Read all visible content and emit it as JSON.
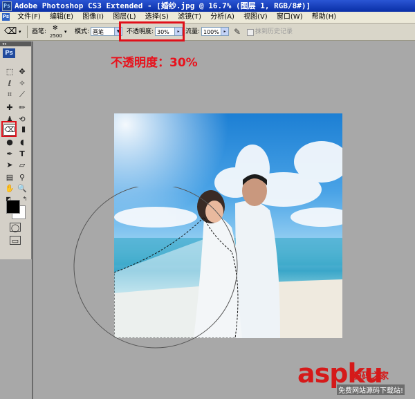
{
  "window": {
    "title": "Adobe Photoshop CS3 Extended - [婚纱.jpg @ 16.7% (图层 1, RGB/8#)]",
    "badge": "Ps"
  },
  "menu": {
    "app_icon": "Ps",
    "items": [
      "文件(F)",
      "编辑(E)",
      "图像(I)",
      "图层(L)",
      "选择(S)",
      "滤镜(T)",
      "分析(A)",
      "视图(V)",
      "窗口(W)",
      "帮助(H)"
    ]
  },
  "options": {
    "brush_label": "画笔:",
    "brush_size": "2500",
    "mode_label": "模式:",
    "mode_value": "画笔",
    "opacity_label": "不透明度:",
    "opacity_value": "30%",
    "flow_label": "流量:",
    "flow_value": "100%",
    "history_label": "抹到历史记录"
  },
  "annotation": {
    "text": "不透明度：30%"
  },
  "toolbox": {
    "logo": "Ps",
    "grip": "◂◂",
    "icons": [
      "marquee-icon",
      "move-icon",
      "lasso-icon",
      "magic-wand-icon",
      "crop-icon",
      "slice-icon",
      "healing-brush-icon",
      "brush-icon",
      "clone-stamp-icon",
      "history-brush-icon",
      "eraser-icon",
      "gradient-icon",
      "blur-icon",
      "dodge-icon",
      "pen-icon",
      "type-icon",
      "path-select-icon",
      "shape-icon",
      "notes-icon",
      "eyedropper-icon",
      "hand-icon",
      "zoom-icon"
    ],
    "foreground_color": "#000000",
    "background_color": "#ffffff"
  },
  "colors": {
    "highlight": "#e0101a",
    "annotation": "#e8111c",
    "titlebar": "#0a2fa6"
  },
  "watermark": {
    "logo": "aspku",
    "suffix": "源码之家",
    "caption": "免费网站源码下载站!"
  }
}
